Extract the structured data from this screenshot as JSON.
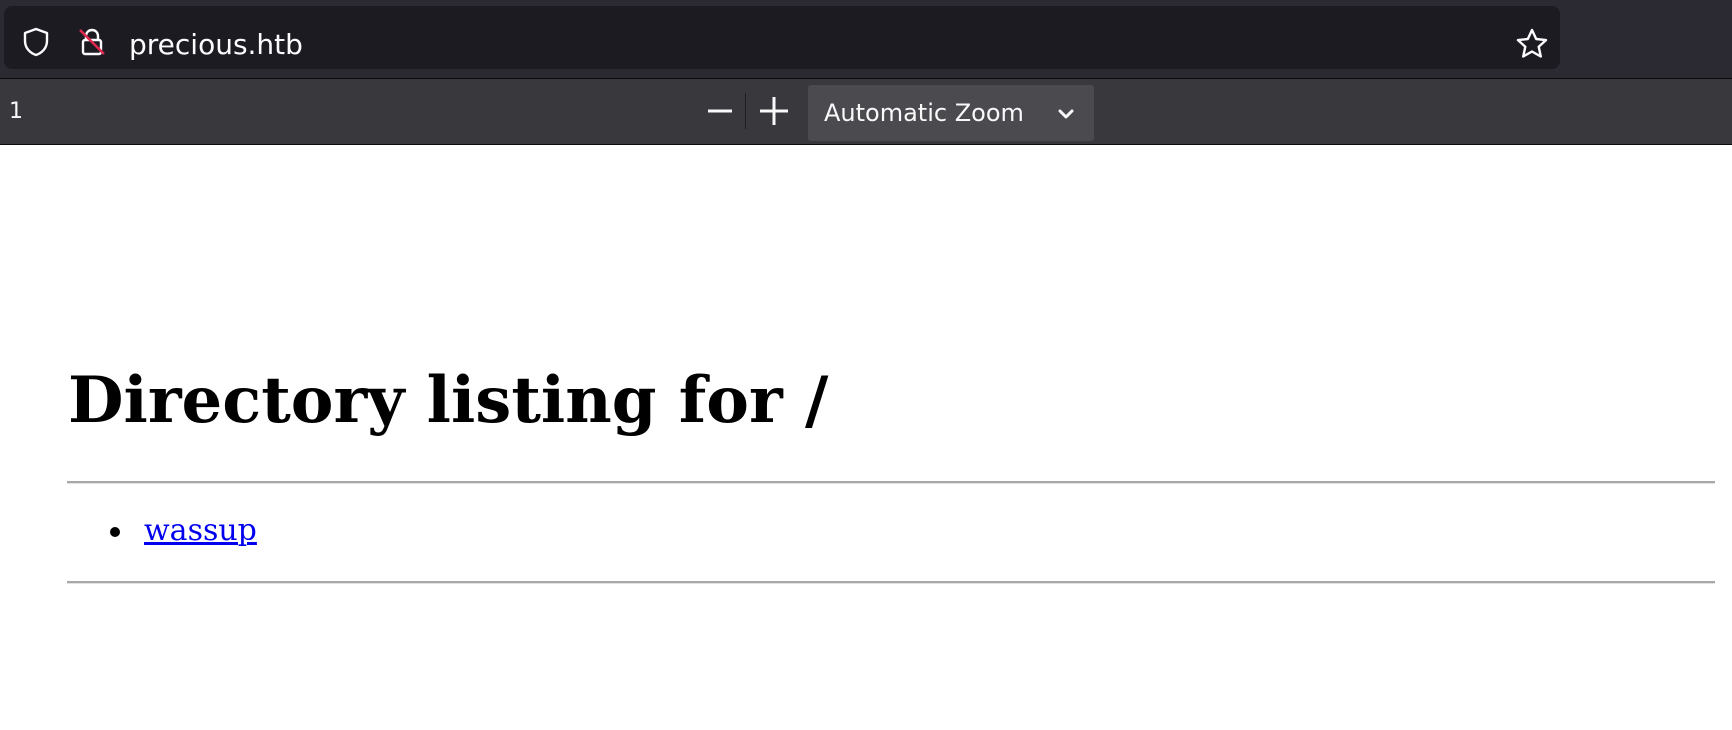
{
  "browser": {
    "url": "precious.htb",
    "icons": [
      "shield-icon",
      "lock-insecure-icon",
      "star-icon"
    ]
  },
  "pdf_toolbar": {
    "page_number": "1",
    "zoom_out_icon": "minus-icon",
    "zoom_in_icon": "plus-icon",
    "zoom_value": "Automatic Zoom",
    "zoom_chevron_icon": "chevron-down-icon"
  },
  "document": {
    "heading": "Directory listing for /",
    "entries": [
      {
        "label": "wassup"
      }
    ]
  },
  "colors": {
    "chrome_bg": "#2b2a33",
    "urlbar_bg": "#1c1b22",
    "toolbar_bg": "#38383d",
    "zoom_select_bg": "#4a4a4f",
    "link": "#0000ee",
    "insecure_slash": "#e22850"
  }
}
